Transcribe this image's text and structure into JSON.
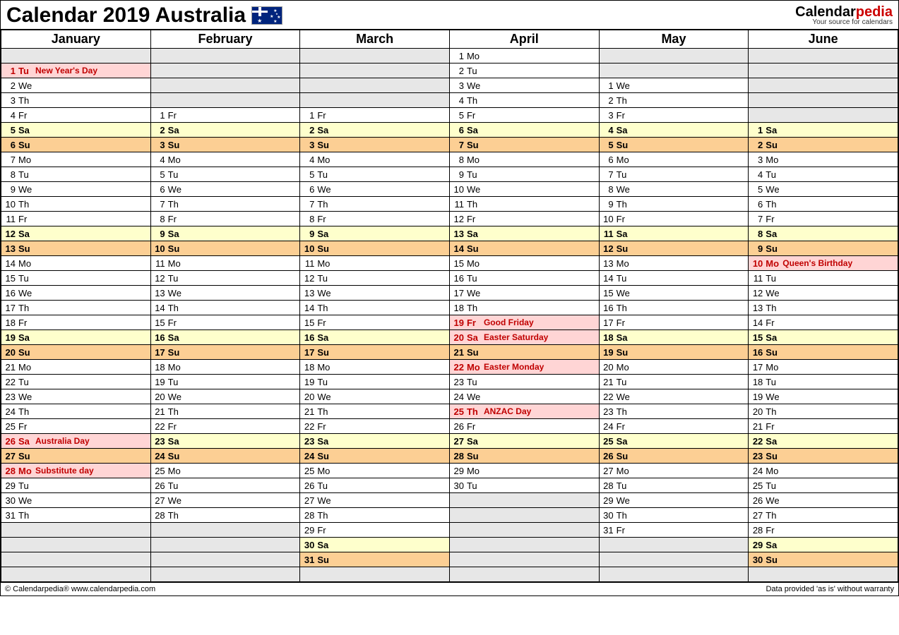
{
  "title": "Calendar 2019 Australia",
  "logo": {
    "part1": "Calendar",
    "part2": "pedia",
    "tagline": "Your source for calendars"
  },
  "footer_left": "© Calendarpedia®   www.calendarpedia.com",
  "footer_right": "Data provided 'as is' without warranty",
  "months": [
    "January",
    "February",
    "March",
    "April",
    "May",
    "June"
  ],
  "rows": 36,
  "columns": [
    {
      "offset": 1,
      "days": [
        {
          "n": 1,
          "d": "Tu",
          "t": "hol",
          "e": "New Year's Day"
        },
        {
          "n": 2,
          "d": "We"
        },
        {
          "n": 3,
          "d": "Th"
        },
        {
          "n": 4,
          "d": "Fr"
        },
        {
          "n": 5,
          "d": "Sa",
          "t": "sat"
        },
        {
          "n": 6,
          "d": "Su",
          "t": "sun"
        },
        {
          "n": 7,
          "d": "Mo"
        },
        {
          "n": 8,
          "d": "Tu"
        },
        {
          "n": 9,
          "d": "We"
        },
        {
          "n": 10,
          "d": "Th"
        },
        {
          "n": 11,
          "d": "Fr"
        },
        {
          "n": 12,
          "d": "Sa",
          "t": "sat"
        },
        {
          "n": 13,
          "d": "Su",
          "t": "sun"
        },
        {
          "n": 14,
          "d": "Mo"
        },
        {
          "n": 15,
          "d": "Tu"
        },
        {
          "n": 16,
          "d": "We"
        },
        {
          "n": 17,
          "d": "Th"
        },
        {
          "n": 18,
          "d": "Fr"
        },
        {
          "n": 19,
          "d": "Sa",
          "t": "sat"
        },
        {
          "n": 20,
          "d": "Su",
          "t": "sun"
        },
        {
          "n": 21,
          "d": "Mo"
        },
        {
          "n": 22,
          "d": "Tu"
        },
        {
          "n": 23,
          "d": "We"
        },
        {
          "n": 24,
          "d": "Th"
        },
        {
          "n": 25,
          "d": "Fr"
        },
        {
          "n": 26,
          "d": "Sa",
          "t": "hol",
          "e": "Australia Day"
        },
        {
          "n": 27,
          "d": "Su",
          "t": "sun"
        },
        {
          "n": 28,
          "d": "Mo",
          "t": "hol",
          "e": "Substitute day"
        },
        {
          "n": 29,
          "d": "Tu"
        },
        {
          "n": 30,
          "d": "We"
        },
        {
          "n": 31,
          "d": "Th"
        }
      ]
    },
    {
      "offset": 4,
      "days": [
        {
          "n": 1,
          "d": "Fr"
        },
        {
          "n": 2,
          "d": "Sa",
          "t": "sat"
        },
        {
          "n": 3,
          "d": "Su",
          "t": "sun"
        },
        {
          "n": 4,
          "d": "Mo"
        },
        {
          "n": 5,
          "d": "Tu"
        },
        {
          "n": 6,
          "d": "We"
        },
        {
          "n": 7,
          "d": "Th"
        },
        {
          "n": 8,
          "d": "Fr"
        },
        {
          "n": 9,
          "d": "Sa",
          "t": "sat"
        },
        {
          "n": 10,
          "d": "Su",
          "t": "sun"
        },
        {
          "n": 11,
          "d": "Mo"
        },
        {
          "n": 12,
          "d": "Tu"
        },
        {
          "n": 13,
          "d": "We"
        },
        {
          "n": 14,
          "d": "Th"
        },
        {
          "n": 15,
          "d": "Fr"
        },
        {
          "n": 16,
          "d": "Sa",
          "t": "sat"
        },
        {
          "n": 17,
          "d": "Su",
          "t": "sun"
        },
        {
          "n": 18,
          "d": "Mo"
        },
        {
          "n": 19,
          "d": "Tu"
        },
        {
          "n": 20,
          "d": "We"
        },
        {
          "n": 21,
          "d": "Th"
        },
        {
          "n": 22,
          "d": "Fr"
        },
        {
          "n": 23,
          "d": "Sa",
          "t": "sat"
        },
        {
          "n": 24,
          "d": "Su",
          "t": "sun"
        },
        {
          "n": 25,
          "d": "Mo"
        },
        {
          "n": 26,
          "d": "Tu"
        },
        {
          "n": 27,
          "d": "We"
        },
        {
          "n": 28,
          "d": "Th"
        }
      ]
    },
    {
      "offset": 4,
      "days": [
        {
          "n": 1,
          "d": "Fr"
        },
        {
          "n": 2,
          "d": "Sa",
          "t": "sat"
        },
        {
          "n": 3,
          "d": "Su",
          "t": "sun"
        },
        {
          "n": 4,
          "d": "Mo"
        },
        {
          "n": 5,
          "d": "Tu"
        },
        {
          "n": 6,
          "d": "We"
        },
        {
          "n": 7,
          "d": "Th"
        },
        {
          "n": 8,
          "d": "Fr"
        },
        {
          "n": 9,
          "d": "Sa",
          "t": "sat"
        },
        {
          "n": 10,
          "d": "Su",
          "t": "sun"
        },
        {
          "n": 11,
          "d": "Mo"
        },
        {
          "n": 12,
          "d": "Tu"
        },
        {
          "n": 13,
          "d": "We"
        },
        {
          "n": 14,
          "d": "Th"
        },
        {
          "n": 15,
          "d": "Fr"
        },
        {
          "n": 16,
          "d": "Sa",
          "t": "sat"
        },
        {
          "n": 17,
          "d": "Su",
          "t": "sun"
        },
        {
          "n": 18,
          "d": "Mo"
        },
        {
          "n": 19,
          "d": "Tu"
        },
        {
          "n": 20,
          "d": "We"
        },
        {
          "n": 21,
          "d": "Th"
        },
        {
          "n": 22,
          "d": "Fr"
        },
        {
          "n": 23,
          "d": "Sa",
          "t": "sat"
        },
        {
          "n": 24,
          "d": "Su",
          "t": "sun"
        },
        {
          "n": 25,
          "d": "Mo"
        },
        {
          "n": 26,
          "d": "Tu"
        },
        {
          "n": 27,
          "d": "We"
        },
        {
          "n": 28,
          "d": "Th"
        },
        {
          "n": 29,
          "d": "Fr"
        },
        {
          "n": 30,
          "d": "Sa",
          "t": "sat"
        },
        {
          "n": 31,
          "d": "Su",
          "t": "sun"
        }
      ]
    },
    {
      "offset": 0,
      "days": [
        {
          "n": 1,
          "d": "Mo"
        },
        {
          "n": 2,
          "d": "Tu"
        },
        {
          "n": 3,
          "d": "We"
        },
        {
          "n": 4,
          "d": "Th"
        },
        {
          "n": 5,
          "d": "Fr"
        },
        {
          "n": 6,
          "d": "Sa",
          "t": "sat"
        },
        {
          "n": 7,
          "d": "Su",
          "t": "sun"
        },
        {
          "n": 8,
          "d": "Mo"
        },
        {
          "n": 9,
          "d": "Tu"
        },
        {
          "n": 10,
          "d": "We"
        },
        {
          "n": 11,
          "d": "Th"
        },
        {
          "n": 12,
          "d": "Fr"
        },
        {
          "n": 13,
          "d": "Sa",
          "t": "sat"
        },
        {
          "n": 14,
          "d": "Su",
          "t": "sun"
        },
        {
          "n": 15,
          "d": "Mo"
        },
        {
          "n": 16,
          "d": "Tu"
        },
        {
          "n": 17,
          "d": "We"
        },
        {
          "n": 18,
          "d": "Th"
        },
        {
          "n": 19,
          "d": "Fr",
          "t": "hol",
          "e": "Good Friday"
        },
        {
          "n": 20,
          "d": "Sa",
          "t": "hol",
          "e": "Easter Saturday"
        },
        {
          "n": 21,
          "d": "Su",
          "t": "sun"
        },
        {
          "n": 22,
          "d": "Mo",
          "t": "hol",
          "e": "Easter Monday"
        },
        {
          "n": 23,
          "d": "Tu"
        },
        {
          "n": 24,
          "d": "We"
        },
        {
          "n": 25,
          "d": "Th",
          "t": "hol",
          "e": "ANZAC Day"
        },
        {
          "n": 26,
          "d": "Fr"
        },
        {
          "n": 27,
          "d": "Sa",
          "t": "sat"
        },
        {
          "n": 28,
          "d": "Su",
          "t": "sun"
        },
        {
          "n": 29,
          "d": "Mo"
        },
        {
          "n": 30,
          "d": "Tu"
        }
      ]
    },
    {
      "offset": 2,
      "days": [
        {
          "n": 1,
          "d": "We"
        },
        {
          "n": 2,
          "d": "Th"
        },
        {
          "n": 3,
          "d": "Fr"
        },
        {
          "n": 4,
          "d": "Sa",
          "t": "sat"
        },
        {
          "n": 5,
          "d": "Su",
          "t": "sun"
        },
        {
          "n": 6,
          "d": "Mo"
        },
        {
          "n": 7,
          "d": "Tu"
        },
        {
          "n": 8,
          "d": "We"
        },
        {
          "n": 9,
          "d": "Th"
        },
        {
          "n": 10,
          "d": "Fr"
        },
        {
          "n": 11,
          "d": "Sa",
          "t": "sat"
        },
        {
          "n": 12,
          "d": "Su",
          "t": "sun"
        },
        {
          "n": 13,
          "d": "Mo"
        },
        {
          "n": 14,
          "d": "Tu"
        },
        {
          "n": 15,
          "d": "We"
        },
        {
          "n": 16,
          "d": "Th"
        },
        {
          "n": 17,
          "d": "Fr"
        },
        {
          "n": 18,
          "d": "Sa",
          "t": "sat"
        },
        {
          "n": 19,
          "d": "Su",
          "t": "sun"
        },
        {
          "n": 20,
          "d": "Mo"
        },
        {
          "n": 21,
          "d": "Tu"
        },
        {
          "n": 22,
          "d": "We"
        },
        {
          "n": 23,
          "d": "Th"
        },
        {
          "n": 24,
          "d": "Fr"
        },
        {
          "n": 25,
          "d": "Sa",
          "t": "sat"
        },
        {
          "n": 26,
          "d": "Su",
          "t": "sun"
        },
        {
          "n": 27,
          "d": "Mo"
        },
        {
          "n": 28,
          "d": "Tu"
        },
        {
          "n": 29,
          "d": "We"
        },
        {
          "n": 30,
          "d": "Th"
        },
        {
          "n": 31,
          "d": "Fr"
        }
      ]
    },
    {
      "offset": 5,
      "days": [
        {
          "n": 1,
          "d": "Sa",
          "t": "sat"
        },
        {
          "n": 2,
          "d": "Su",
          "t": "sun"
        },
        {
          "n": 3,
          "d": "Mo"
        },
        {
          "n": 4,
          "d": "Tu"
        },
        {
          "n": 5,
          "d": "We"
        },
        {
          "n": 6,
          "d": "Th"
        },
        {
          "n": 7,
          "d": "Fr"
        },
        {
          "n": 8,
          "d": "Sa",
          "t": "sat"
        },
        {
          "n": 9,
          "d": "Su",
          "t": "sun"
        },
        {
          "n": 10,
          "d": "Mo",
          "t": "hol",
          "e": "Queen's Birthday"
        },
        {
          "n": 11,
          "d": "Tu"
        },
        {
          "n": 12,
          "d": "We"
        },
        {
          "n": 13,
          "d": "Th"
        },
        {
          "n": 14,
          "d": "Fr"
        },
        {
          "n": 15,
          "d": "Sa",
          "t": "sat"
        },
        {
          "n": 16,
          "d": "Su",
          "t": "sun"
        },
        {
          "n": 17,
          "d": "Mo"
        },
        {
          "n": 18,
          "d": "Tu"
        },
        {
          "n": 19,
          "d": "We"
        },
        {
          "n": 20,
          "d": "Th"
        },
        {
          "n": 21,
          "d": "Fr"
        },
        {
          "n": 22,
          "d": "Sa",
          "t": "sat"
        },
        {
          "n": 23,
          "d": "Su",
          "t": "sun"
        },
        {
          "n": 24,
          "d": "Mo"
        },
        {
          "n": 25,
          "d": "Tu"
        },
        {
          "n": 26,
          "d": "We"
        },
        {
          "n": 27,
          "d": "Th"
        },
        {
          "n": 28,
          "d": "Fr"
        },
        {
          "n": 29,
          "d": "Sa",
          "t": "sat"
        },
        {
          "n": 30,
          "d": "Su",
          "t": "sun"
        }
      ]
    }
  ]
}
